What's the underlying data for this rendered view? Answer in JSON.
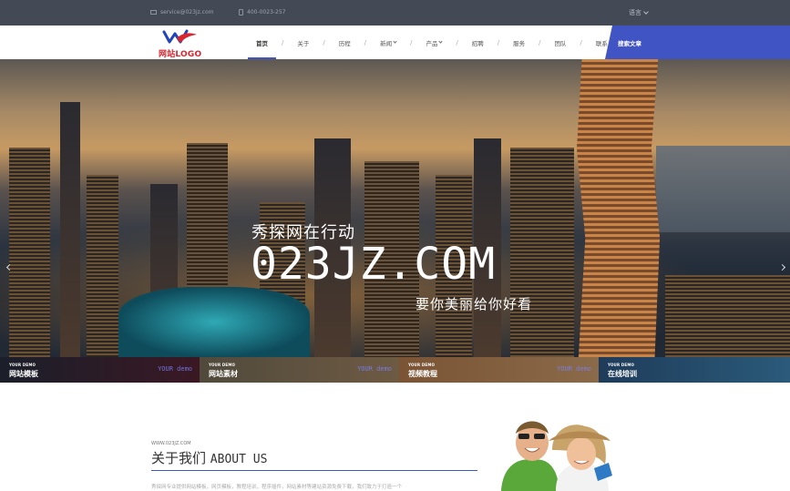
{
  "topbar": {
    "email": "service@023jz.com",
    "phone": "400-0023-257",
    "language": "语言"
  },
  "header": {
    "logo_text": "网站LOGO",
    "nav": [
      {
        "label": "首页",
        "active": true
      },
      {
        "label": "关于"
      },
      {
        "label": "历程"
      },
      {
        "label": "新闻",
        "dropdown": true
      },
      {
        "label": "产品",
        "dropdown": true
      },
      {
        "label": "招聘"
      },
      {
        "label": "服务"
      },
      {
        "label": "团队"
      },
      {
        "label": "联系"
      }
    ],
    "search_label": "搜索文章"
  },
  "hero": {
    "subtitle": "秀探网在行动",
    "title": "023JZ.COM",
    "tagline": "要你美丽给你好看"
  },
  "features": [
    {
      "small": "YOUR DEMO",
      "label": "网站模板",
      "ghost": "YOUR demo"
    },
    {
      "small": "YOUR DEMO",
      "label": "网站素材",
      "ghost": "YOUR demo"
    },
    {
      "small": "YOUR DEMO",
      "label": "视频教程",
      "ghost": "YOUR demo"
    },
    {
      "small": "YOUR DEMO",
      "label": "在线培训",
      "ghost": ""
    }
  ],
  "about": {
    "small": "WWW.023JZ.COM",
    "title_cn": "关于我们",
    "title_en": "ABOUT US",
    "text": "秀探网专业提供网站模板，网页模板，教程培训，程序插件，网站素材等建站资源免费下载，我们致力于打造一个"
  },
  "colors": {
    "accent": "#4054c4",
    "topbar": "#434a56",
    "logo_red": "#d7262f"
  }
}
